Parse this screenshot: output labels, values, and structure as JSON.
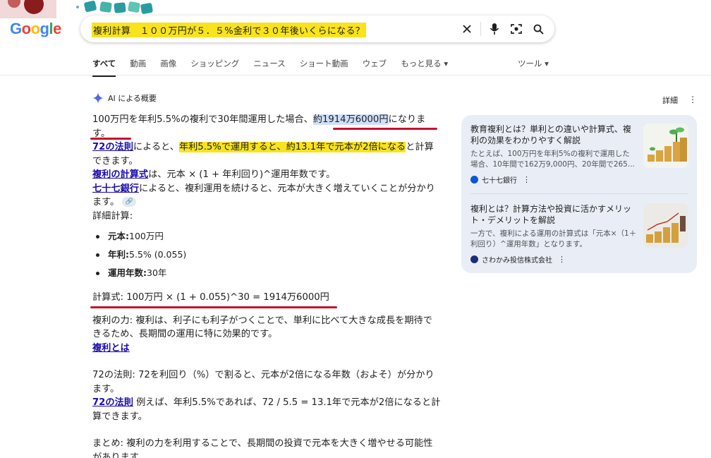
{
  "header": {
    "logo": "Google",
    "search_query": "複利計算　１００万円が５．５%金利で３０年後いくらになる？"
  },
  "tabs": [
    {
      "label": "すべて",
      "active": true
    },
    {
      "label": "動画"
    },
    {
      "label": "画像"
    },
    {
      "label": "ショッピング"
    },
    {
      "label": "ニュース"
    },
    {
      "label": "ショート動画"
    },
    {
      "label": "ウェブ"
    },
    {
      "label": "もっと見る ▾"
    }
  ],
  "tools_label": "ツール ▾",
  "ai_overview": {
    "heading": "AI による概要",
    "details_label": "詳細",
    "p1_a": "100万円を年利5.5%の複利で30年間運用した場合、",
    "p1_b": "約1914万6000円",
    "p1_c": "になります。",
    "link_72": "72の法則",
    "p2_a": "によると、",
    "p2_b": "年利5.5%で運用すると、約13.1年で元本が2倍になる",
    "p2_c": "と計算できます。",
    "link_formula": "複利の計算式",
    "p3": "は、元本 × (1 + 年利回り)^運用年数です。",
    "link_bank": "七十七銀行",
    "p4": "によると、複利運用を続けると、元本が大きく増えていくことが分かります。",
    "detail_heading": "詳細計算:",
    "params": [
      {
        "label": "元本:",
        "value": "100万円"
      },
      {
        "label": "年利:",
        "value": "5.5% (0.055)"
      },
      {
        "label": "運用年数:",
        "value": "30年"
      }
    ],
    "formula": "計算式: 100万円 × (1 + 0.055)^30 = 1914万6000円",
    "power": "複利の力: 複利は、利子にも利子がつくことで、単利に比べて大きな成長を期待できるため、長期間の運用に特に効果的です。",
    "link_what": "複利とは",
    "rule72": "72の法則: 72を利回り（%）で割ると、元本が2倍になる年数（およそ）が分かります。",
    "link_72b": "72の法則",
    "rule72_ex": " 例えば、年利5.5%であれば、72 / 5.5 = 13.1年で元本が2倍になると計算できます。",
    "summary": "まとめ: 複利の力を利用することで、長期間の投資で元本を大きく増やせる可能性があります。"
  },
  "sources": [
    {
      "title": "教育複利とは？単利との違いや計算式、複利の効果をわかりやすく解説",
      "snippet": "たとえば、100万円を年利5%の複利で運用した場合、10年間で162万9,000円、20年間で265...",
      "site": "七十七銀行",
      "color": "#0b57d0"
    },
    {
      "title": "複利とは？計算方法や投資に活かすメリット・デメリットを解説",
      "snippet": "一方で、複利による運用の計算式は「元本×（1＋利回り）^運用年数」となります。",
      "site": "さわかみ投信株式会社",
      "color": "#1a2f7a"
    }
  ],
  "colors": {
    "highlight": "#f8e31c",
    "selection": "#cfe0fb",
    "annotation_underline": "#c8102e",
    "link": "#1a0dab",
    "panel_bg": "#e9eef6"
  }
}
